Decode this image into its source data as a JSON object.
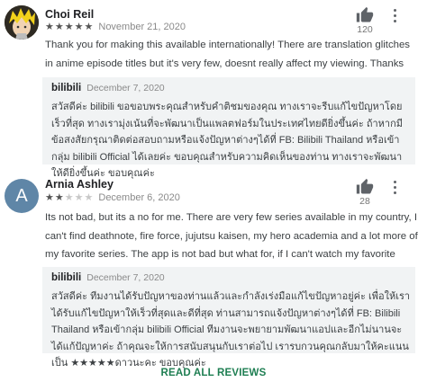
{
  "reviews": [
    {
      "author": "Choi Reil",
      "rating": 5,
      "date": "November 21, 2020",
      "helpful_count": "120",
      "text": "Thank you for making this available internationally! There are translation glitches in anime episode titles but it's very few, doesnt really affect my viewing. Thanks again!",
      "reply": {
        "author": "bilibili",
        "date": "December 7, 2020",
        "text": "สวัสดีค่ะ bilibili ขอขอบพระคุณสำหรับคำติชมของคุณ ทางเราจะรีบแก้ไขปัญหาโดยเร็วที่สุด ทางเรามุ่งเน้นที่จะพัฒนาเป็นแพลตฟอร์มในประเทศไทยดียิ่งขึ้นค่ะ ถ้าหากมีข้อสงสัยกรุณาติดต่อสอบถามหรือแจ้งปัญหาต่างๆได้ที่ FB: Bilibili Thailand หรือเข้ากลุ่ม bilibili Official ได้เลยค่ะ ขอบคุณสำหรับความคิดเห็นของท่าน ทางเราจะพัฒนาให้ดียิ่งขึ้นค่ะ ขอบคุณค่ะ"
      }
    },
    {
      "author": "Arnia Ashley",
      "avatar_letter": "A",
      "rating": 2,
      "date": "December 6, 2020",
      "helpful_count": "28",
      "text": "Its not bad, but its a no for me. There are very few series available in my country, I can't find deathnote, fire force, jujutsu kaisen, my hero academia and a lot more of my favorite series. The app is not bad but what for, if I can't watch my favorite anime series :<",
      "reply": {
        "author": "bilibili",
        "date": "December 7, 2020",
        "text": "สวัสดีค่ะ ทีมงานได้รับปัญหาของท่านแล้วและกำลังเร่งมือแก้ไขปัญหาอยู่ค่ะ เพื่อให้เราได้รับแก้ไขปัญหาให้เร็วที่สุดและดีที่สุด ท่านสามารถแจ้งปัญหาต่างๆได้ที่ FB: Bilibili Thailand หรือเข้ากลุ่ม bilibili Official ทีมงานจะพยายามพัฒนาแอปและอีกไม่นานจะได้แก้ปัญหาค่ะ ถ้าคุณจะให้การสนับสนุนกับเราต่อไป เรารบกวนคุณกลับมาให้คะแนนเป็น ★★★★★ดาวนะคะ ขอบคุณค่ะ"
      }
    }
  ],
  "footer": {
    "read_all_label": "READ ALL REVIEWS"
  },
  "colors": {
    "accent": "#1e7e52",
    "reply_bg": "#f1f3f4",
    "avatar_a": "#5f86a7"
  }
}
